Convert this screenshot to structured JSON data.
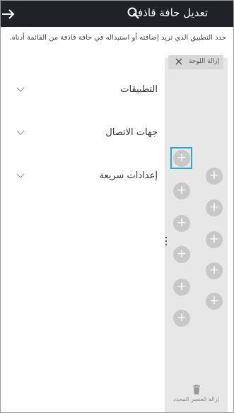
{
  "header": {
    "title": "تعديل حافة قاذفة",
    "back_icon": "arrow-right-icon",
    "search_icon": "search-icon"
  },
  "description": "حدد التطبيق الذي تريد إضافته أو استبداله في حافة قاذفة من القائمة أدناه.",
  "categories": [
    {
      "label": "التطبيقات",
      "icon": "chevron-down-icon"
    },
    {
      "label": "جهات الاتصال",
      "icon": "chevron-down-icon"
    },
    {
      "label": "إعدادات سريعة",
      "icon": "chevron-down-icon"
    }
  ],
  "edge_panel": {
    "remove_panel_label": "إزالة اللوحة",
    "remove_panel_icon": "close-icon",
    "slot_symbol": "+",
    "remove_item_label": "إزالة العنصر المحدد",
    "remove_item_icon": "trash-icon"
  },
  "colors": {
    "header_bg": "#1f2226",
    "panel_bg": "#e7e7e7",
    "selection": "#2aa6d6",
    "slot": "#c8c8c8"
  }
}
